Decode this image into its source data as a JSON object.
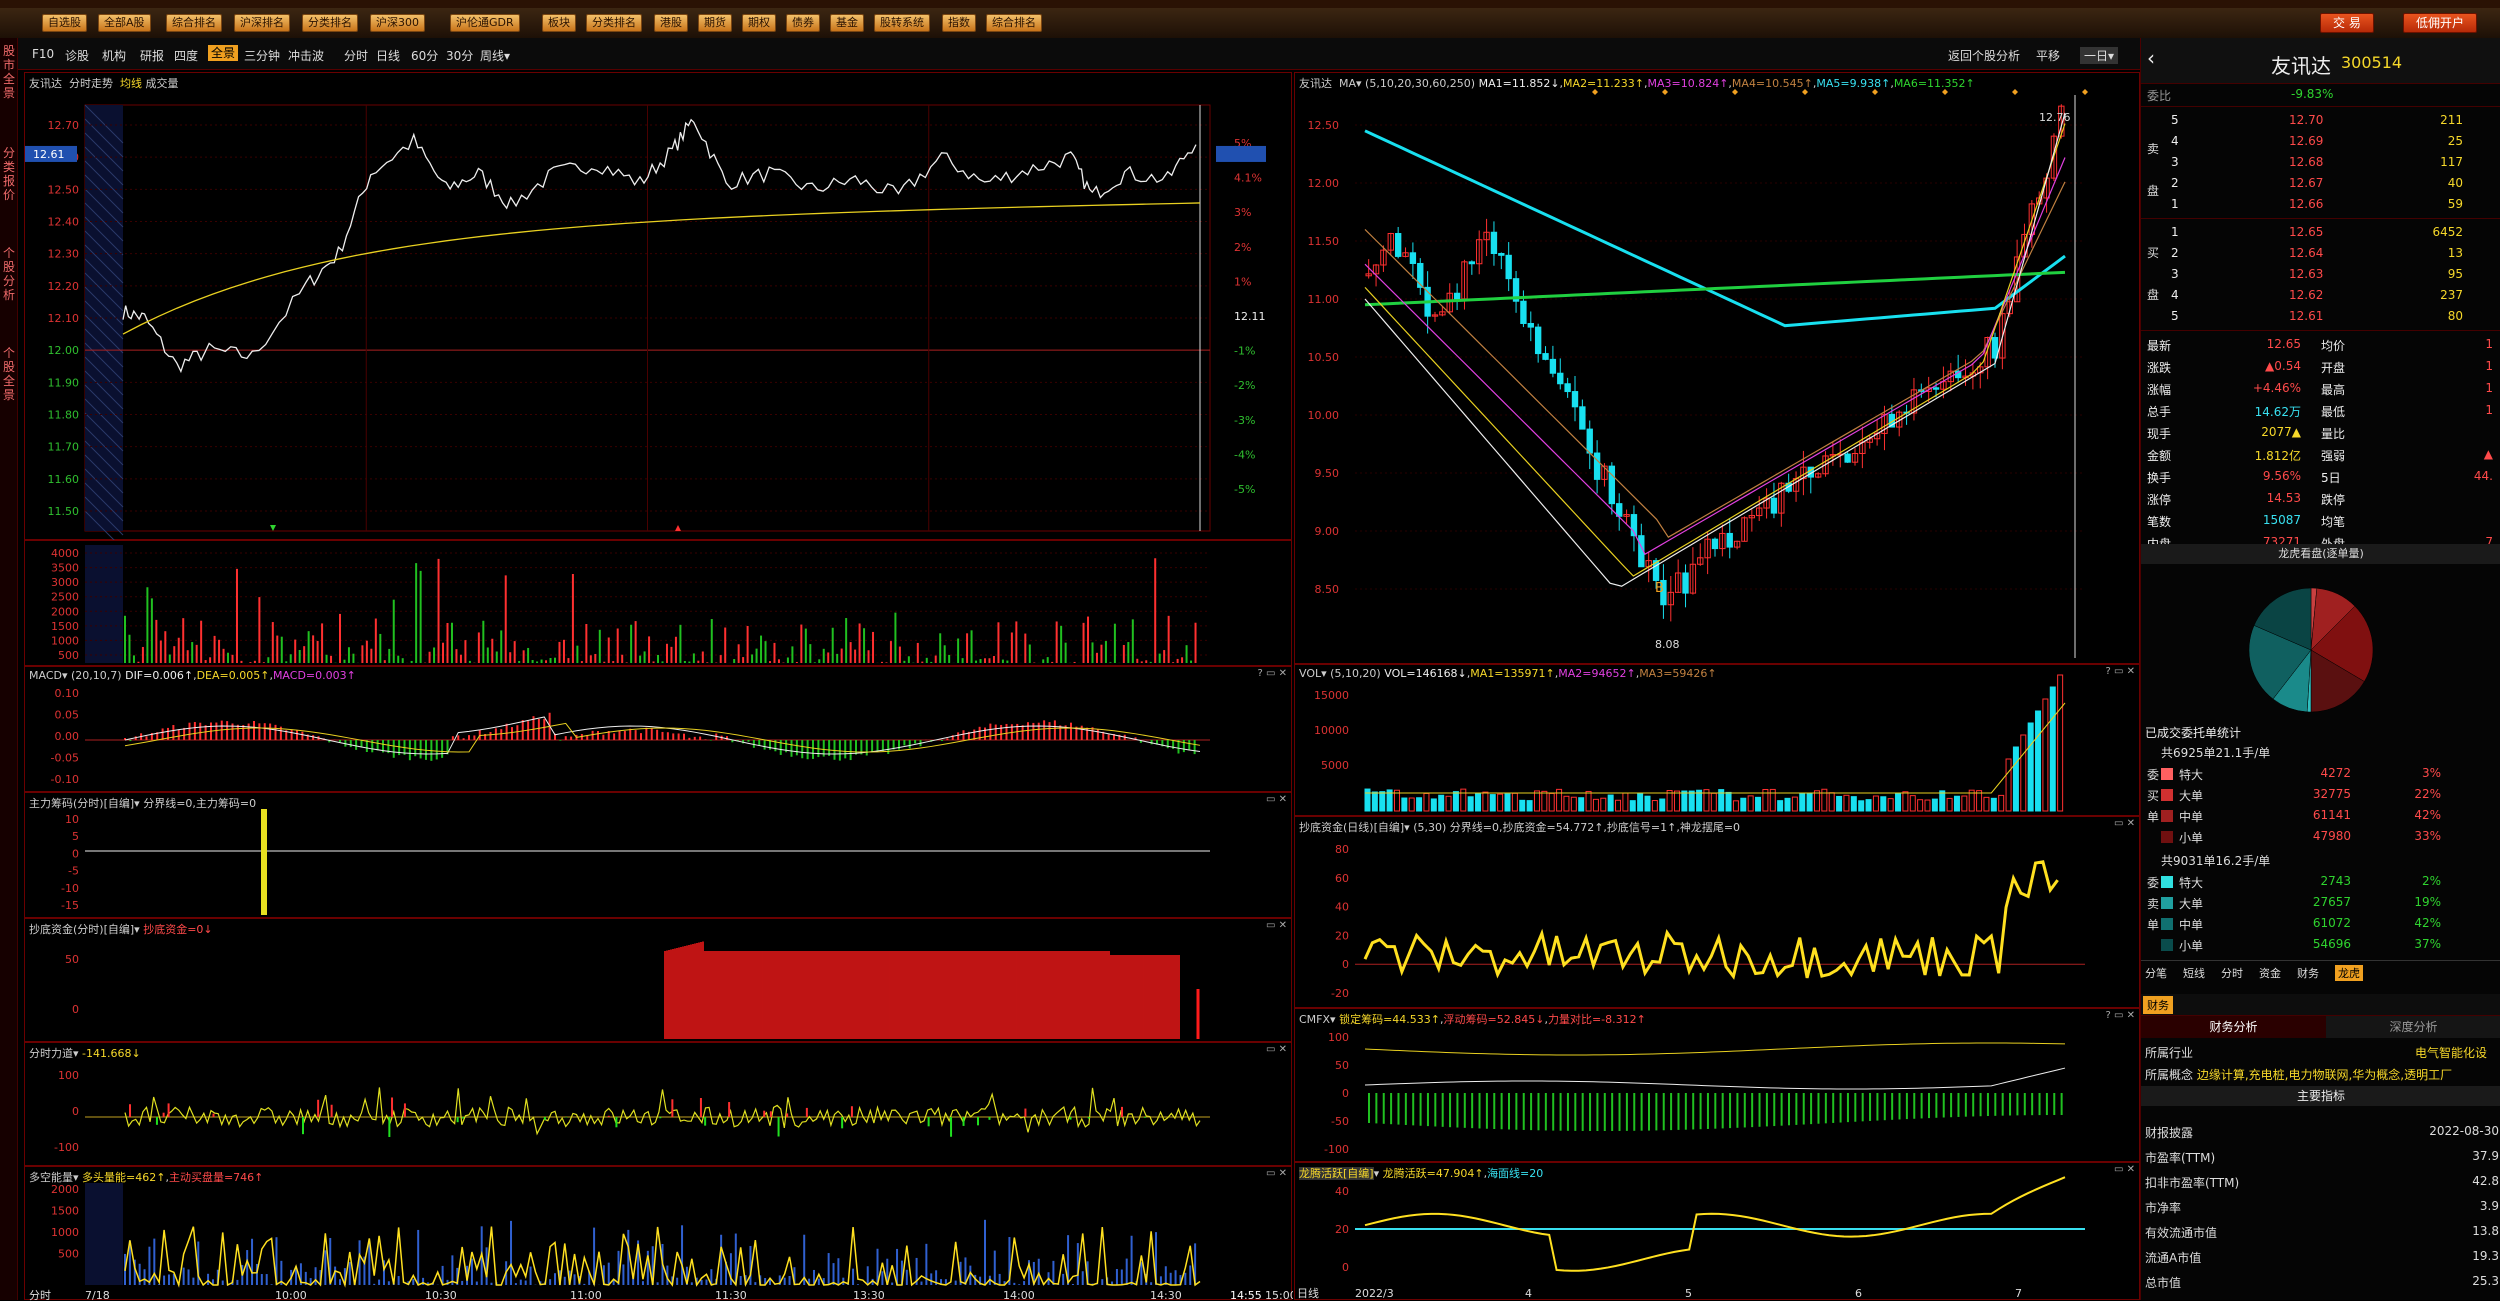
{
  "menubar": {
    "buttons": [
      "自选股",
      "全部A股",
      "综合排名",
      "沪深排名",
      "分类排名",
      "沪深300",
      "沪伦通GDR",
      "板块",
      "分类排名",
      "港股",
      "期货",
      "期权",
      "债券",
      "基金",
      "股转系统",
      "指数",
      "综合排名"
    ],
    "trade": "交 易",
    "account": "低佣开户"
  },
  "leftnav": {
    "items": [
      "股市全景",
      "分类报价",
      "个股分析",
      "个股全景"
    ]
  },
  "subtool": {
    "items": [
      "F10",
      "诊股",
      "机构",
      "研报",
      "四度",
      "全景",
      "三分钟",
      "冲击波",
      "分时",
      "日线",
      "60分",
      "30分",
      "周线▾"
    ],
    "active": "全景",
    "back": "返回个股分析",
    "flat": "平移",
    "dropdown": "一日▾"
  },
  "intraday": {
    "title": "友讯达",
    "subtitle": "分时走势",
    "avg": "均线",
    "vol": "成交量",
    "yprice": [
      "12.70",
      "12.60",
      "12.50",
      "12.40",
      "12.30",
      "12.20",
      "12.10",
      "12.00",
      "11.90",
      "11.80",
      "11.70",
      "11.60",
      "11.50"
    ],
    "ypct": [
      "5%",
      "4.1%",
      "3%",
      "2%",
      "1%",
      "12.11",
      "-1%",
      "-2%",
      "-3%",
      "-4%",
      "-5%"
    ],
    "current_price": "12.61",
    "vol_y": [
      "4000",
      "3500",
      "3000",
      "2500",
      "2000",
      "1500",
      "1000",
      "500"
    ],
    "xaxis": [
      "分时",
      "7/18",
      "10:00",
      "10:30",
      "11:00",
      "11:30",
      "13:30",
      "14:00",
      "14:30",
      "14:55",
      "15:00"
    ]
  },
  "macd": {
    "title": "MACD",
    "params": "(20,10,7)",
    "dif": "DIF=0.006↑",
    "dea": "DEA=0.005↑",
    "macd": "MACD=0.003↑",
    "y": [
      "0.10",
      "0.05",
      "0.00",
      "-0.05",
      "-0.10"
    ]
  },
  "zhuli": {
    "title": "主力筹码(分时)[自编]",
    "text": "分界线=0,主力筹码=0",
    "y": [
      "10",
      "5",
      "0",
      "-5",
      "-10",
      "-15"
    ]
  },
  "chaodi_m": {
    "title": "抄底资金(分时)[自编]",
    "text": "抄底资金=0↓",
    "y": [
      "50",
      "0"
    ]
  },
  "lidao": {
    "title": "分时力道",
    "text": "-141.668↓",
    "y": [
      "100",
      "0",
      "-100"
    ]
  },
  "duokong": {
    "title": "多空能量",
    "text": "多头量能=462↑",
    "text2": "主动买盘量=746↑",
    "y": [
      "2000",
      "1500",
      "1000",
      "500"
    ]
  },
  "kline": {
    "title": "友讯达",
    "ma_label": "MA",
    "params": "(5,10,20,30,60,250)",
    "ma": [
      "MA1=11.852↓",
      "MA2=11.233↑",
      "MA3=10.824↑",
      "MA4=10.545↑",
      "MA5=9.938↑",
      "MA6=11.352↑"
    ],
    "y": [
      "12.50",
      "12.00",
      "11.50",
      "11.00",
      "10.50",
      "10.00",
      "9.50",
      "9.00",
      "8.50"
    ],
    "high_mark": "12.76",
    "low_mark": "8.08",
    "buy_mark": "B",
    "xaxis": [
      "日线",
      "2022/3",
      "4",
      "5",
      "6",
      "7"
    ]
  },
  "vol": {
    "title": "VOL",
    "params": "(5,10,20)",
    "values": "VOL=146168↓",
    "ma1": "MA1=135971↑",
    "ma2": "MA2=94652↑",
    "ma3": "MA3=59426↑",
    "y": [
      "15000",
      "10000",
      "5000"
    ]
  },
  "chaodi_d": {
    "title": "抄底资金(日线)[自编]",
    "params": "(5,30)",
    "text": "分界线=0,抄底资金=54.772↑,抄底信号=1↑,神龙摆尾=0",
    "y": [
      "80",
      "60",
      "40",
      "20",
      "0",
      "-20"
    ]
  },
  "cmfx": {
    "title": "CMFX",
    "t1": "锁定筹码=44.533↑",
    "t2": "浮动筹码=52.845↓",
    "t3": "力量对比=-8.312↑",
    "y": [
      "100",
      "50",
      "0",
      "-50",
      "-100"
    ]
  },
  "longteng": {
    "title": "龙腾活跃[自编]",
    "t1": "龙腾活跃=47.904↑",
    "t2": "海面线=20",
    "y": [
      "40",
      "20",
      "0"
    ]
  },
  "quote": {
    "name": "友讯达",
    "code": "300514",
    "webi_label": "委比",
    "webi": "-9.83%",
    "sell": [
      {
        "lvl": "5",
        "p": "12.70",
        "v": "211"
      },
      {
        "lvl": "4",
        "p": "12.69",
        "v": "25"
      },
      {
        "lvl": "3",
        "p": "12.68",
        "v": "117"
      },
      {
        "lvl": "2",
        "p": "12.67",
        "v": "40"
      },
      {
        "lvl": "1",
        "p": "12.66",
        "v": "59"
      }
    ],
    "buy": [
      {
        "lvl": "1",
        "p": "12.65",
        "v": "6452"
      },
      {
        "lvl": "2",
        "p": "12.64",
        "v": "13"
      },
      {
        "lvl": "3",
        "p": "12.63",
        "v": "95"
      },
      {
        "lvl": "4",
        "p": "12.62",
        "v": "237"
      },
      {
        "lvl": "5",
        "p": "12.61",
        "v": "80"
      }
    ],
    "side_sell": "卖",
    "side_buy": "买",
    "side_pan": "盘",
    "stats": [
      {
        "l": "最新",
        "v": "12.65",
        "l2": "均价",
        "v2": "1"
      },
      {
        "l": "涨跌",
        "v": "▲0.54",
        "l2": "开盘",
        "v2": "1"
      },
      {
        "l": "涨幅",
        "v": "+4.46%",
        "l2": "最高",
        "v2": "1"
      },
      {
        "l": "总手",
        "v": "14.62万",
        "l2": "最低",
        "v2": "1"
      },
      {
        "l": "现手",
        "v": "2077▲",
        "l2": "量比",
        "v2": ""
      },
      {
        "l": "金额",
        "v": "1.812亿",
        "l2": "强弱",
        "v2": "▲"
      },
      {
        "l": "换手",
        "v": "9.56%",
        "l2": "5日",
        "v2": "44."
      },
      {
        "l": "涨停",
        "v": "14.53",
        "l2": "跌停",
        "v2": ""
      },
      {
        "l": "笔数",
        "v": "15087",
        "l2": "均笔",
        "v2": ""
      },
      {
        "l": "内盘",
        "v": "73271",
        "l2": "外盘",
        "v2": "7"
      }
    ],
    "pie_title": "龙虎看盘(逐单量)",
    "deal_title": "已成交委托单统计",
    "buy_total": "共6925单21.1手/单",
    "buy_rows": [
      {
        "n": "特大",
        "v": "4272",
        "p": "3%"
      },
      {
        "n": "大单",
        "v": "32775",
        "p": "22%"
      },
      {
        "n": "中单",
        "v": "61141",
        "p": "42%"
      },
      {
        "n": "小单",
        "v": "47980",
        "p": "33%"
      }
    ],
    "buy_side": [
      "委",
      "买",
      "单"
    ],
    "sell_total": "共9031单16.2手/单",
    "sell_rows": [
      {
        "n": "特大",
        "v": "2743",
        "p": "2%"
      },
      {
        "n": "大单",
        "v": "27657",
        "p": "19%"
      },
      {
        "n": "中单",
        "v": "61072",
        "p": "42%"
      },
      {
        "n": "小单",
        "v": "54696",
        "p": "37%"
      }
    ],
    "sell_side": [
      "委",
      "卖",
      "单"
    ],
    "tabs": [
      "分笔",
      "短线",
      "分时",
      "资金",
      "财务",
      "龙虎"
    ],
    "fin_tab": "财务",
    "fin_sub": [
      "财务分析",
      "深度分析"
    ],
    "industry_l": "所属行业",
    "industry": "电气智能化设",
    "concept_l": "所属概念",
    "concept": "边缘计算,充电桩,电力物联网,华为概念,透明工厂",
    "main_ind": "主要指标",
    "fin_rows": [
      {
        "l": "财报披露",
        "v": "2022-08-30"
      },
      {
        "l": "市盈率(TTM)",
        "v": "37.9"
      },
      {
        "l": "扣非市盈率(TTM)",
        "v": "42.8"
      },
      {
        "l": "市净率",
        "v": "3.9"
      },
      {
        "l": "有效流通市值",
        "v": "13.8"
      },
      {
        "l": "流通A市值",
        "v": "19.3"
      },
      {
        "l": "总市值",
        "v": "25.3"
      }
    ]
  },
  "colors": {
    "up": "#ff3030",
    "down": "#18e0f0",
    "grid": "#6a0000"
  }
}
